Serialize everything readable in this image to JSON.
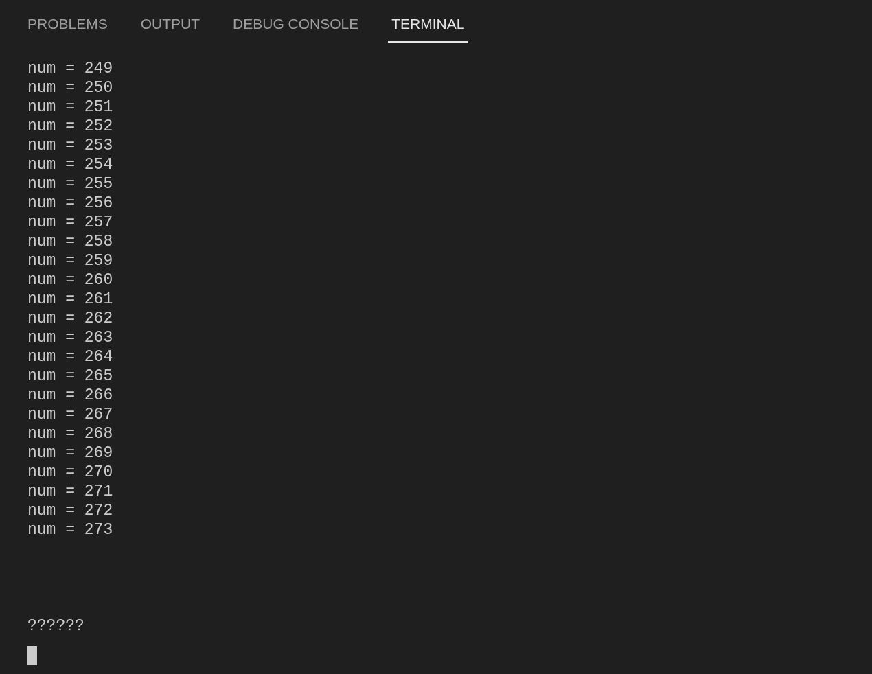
{
  "tabs": [
    {
      "label": "PROBLEMS",
      "selected": false
    },
    {
      "label": "OUTPUT",
      "selected": false
    },
    {
      "label": "DEBUG CONSOLE",
      "selected": false
    },
    {
      "label": "TERMINAL",
      "selected": true
    }
  ],
  "terminal": {
    "lines": [
      "num = 249",
      "num = 250",
      "num = 251",
      "num = 252",
      "num = 253",
      "num = 254",
      "num = 255",
      "num = 256",
      "num = 257",
      "num = 258",
      "num = 259",
      "num = 260",
      "num = 261",
      "num = 262",
      "num = 263",
      "num = 264",
      "num = 265",
      "num = 266",
      "num = 267",
      "num = 268",
      "num = 269",
      "num = 270",
      "num = 271",
      "num = 272",
      "num = 273"
    ],
    "prompt": "??????"
  }
}
